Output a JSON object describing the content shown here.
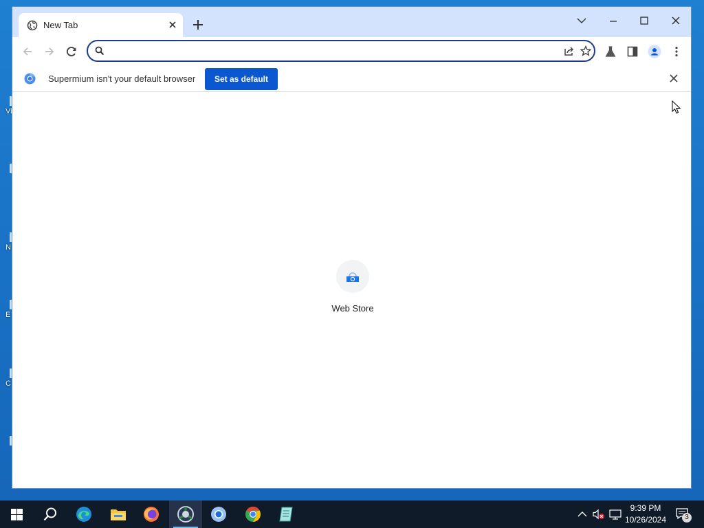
{
  "desktop": {
    "icon_fragments": [
      "Vi",
      "",
      "N",
      "E",
      "C",
      ""
    ]
  },
  "browser": {
    "tab": {
      "title": "New Tab",
      "close_icon": "close-icon",
      "favicon": "globe-icon"
    },
    "new_tab_icon": "plus-icon",
    "window_controls": [
      "chevron-down-icon",
      "minimize-icon",
      "maximize-icon",
      "close-icon"
    ],
    "toolbar": {
      "back_icon": "arrow-left-icon",
      "forward_icon": "arrow-right-icon",
      "reload_icon": "reload-icon",
      "omnibox": {
        "value": "",
        "placeholder": "",
        "search_icon": "search-icon"
      },
      "share_icon": "share-icon",
      "bookmark_icon": "star-icon",
      "labs_icon": "flask-icon",
      "side_panel_icon": "side-panel-icon",
      "profile_icon": "profile-icon",
      "menu_icon": "kebab-menu-icon"
    },
    "infobar": {
      "message": "Supermium isn't your default browser",
      "button_label": "Set as default",
      "close_icon": "close-icon"
    },
    "shortcuts": [
      {
        "label": "Web Store",
        "icon": "web-store-icon"
      }
    ]
  },
  "taskbar": {
    "apps": [
      "start-icon",
      "search-icon",
      "edge-icon",
      "file-explorer-icon",
      "firefox-icon",
      "supermium-icon",
      "chromium-icon",
      "chrome-icon",
      "notepad-icon"
    ],
    "active_app": "supermium-icon",
    "tray": [
      "chevron-up-icon",
      "volume-muted-icon",
      "network-icon"
    ],
    "time": "9:39 PM",
    "date": "10/26/2024",
    "notification_count": "3"
  },
  "colors": {
    "accent": "#0b57d0",
    "titlebar": "#d3e3fd",
    "omnibox_border": "#1f3a8a",
    "taskbar": "#101b2a"
  }
}
